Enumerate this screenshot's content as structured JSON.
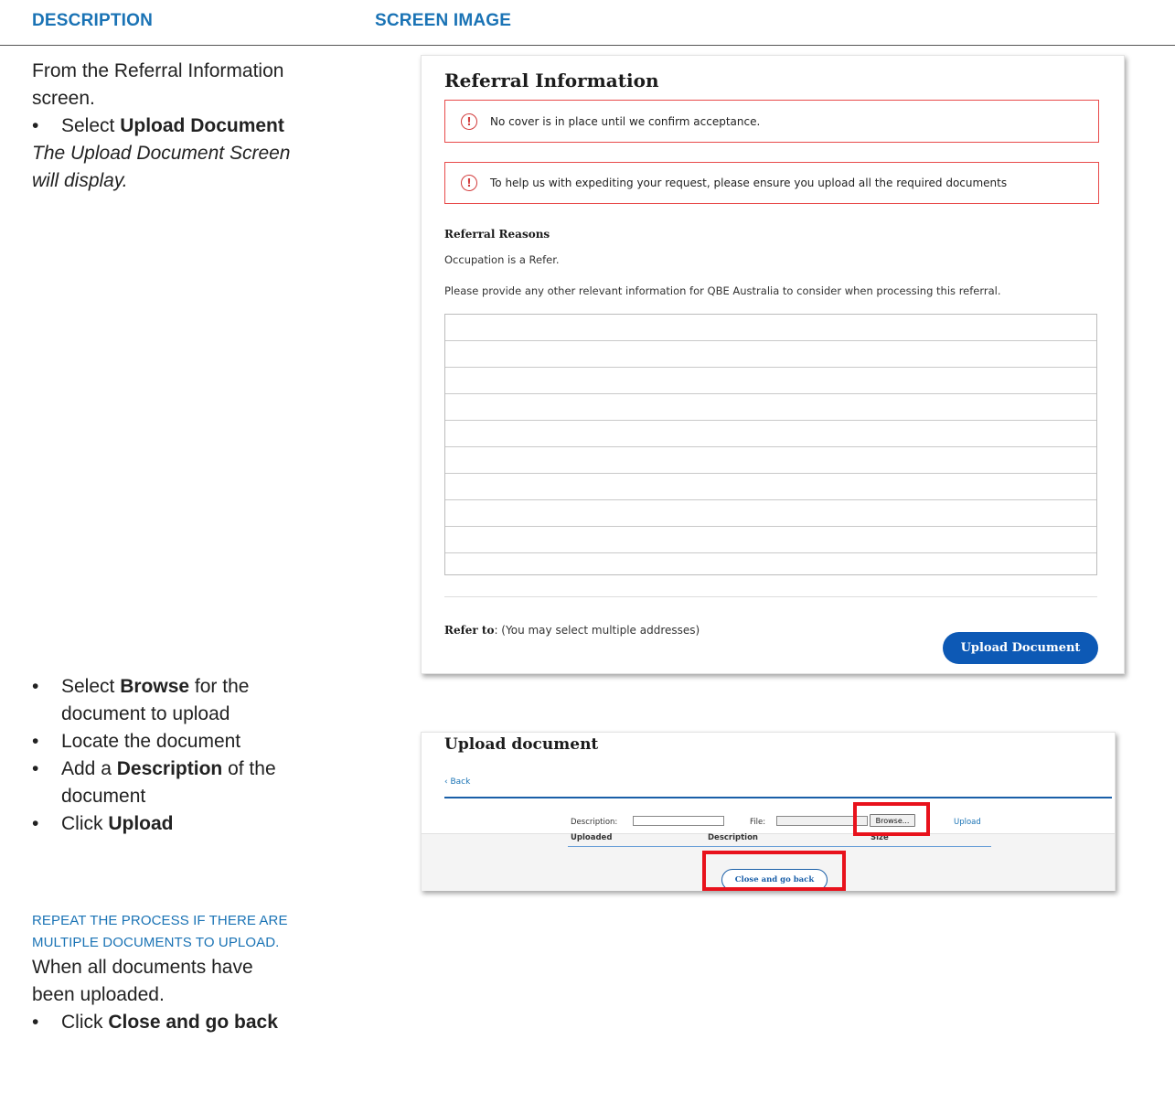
{
  "columns": {
    "description": "DESCRIPTION",
    "screen": "SCREEN IMAGE"
  },
  "step1": {
    "intro_line1": "From the Referral Information",
    "intro_line2": "screen.",
    "bullet_pre": "Select ",
    "bullet_bold": "Upload Document",
    "result_line1": "The Upload Document Screen",
    "result_line2": "will display."
  },
  "step2": {
    "b1_pre": "Select ",
    "b1_bold": "Browse",
    "b1_post": " for the",
    "b1_line2": "document to upload",
    "b2": "Locate the document",
    "b3_pre": "Add a ",
    "b3_bold": "Description",
    "b3_post": " of the",
    "b3_line2": "document",
    "b4_pre": "Click ",
    "b4_bold": "Upload",
    "repeat_line1": "REPEAT THE PROCESS IF THERE ARE",
    "repeat_line2": "MULTIPLE DOCUMENTS TO UPLOAD.",
    "when_line1": "When all documents have",
    "when_line2": "been uploaded.",
    "b5_pre": "Click ",
    "b5_bold": "Close and go back"
  },
  "referral_screen": {
    "title": "Referral Information",
    "alert1": "No cover is in place until we confirm acceptance.",
    "alert2": "To help us with expediting your request, please ensure you upload all the required documents",
    "alert_icon": "!",
    "reasons_heading": "Referral Reasons",
    "reason": "Occupation is a Refer.",
    "prompt": "Please provide any other relevant information for QBE Australia to consider when processing this referral.",
    "refer_label": "Refer to",
    "refer_note": ": (You may select multiple addresses)",
    "upload_button": "Upload Document"
  },
  "upload_screen": {
    "title": "Upload document",
    "back": "‹ Back",
    "description_label": "Description:",
    "file_label": "File:",
    "browse_button": "Browse...",
    "upload_link": "Upload",
    "col_uploaded": "Uploaded",
    "col_description": "Description",
    "col_size": "Size",
    "close_button": "Close and go back"
  },
  "colors": {
    "accent": "#1a73b5",
    "primary_button": "#0d59b5",
    "alert_border": "#e84a4a",
    "highlight": "#e8121c"
  }
}
